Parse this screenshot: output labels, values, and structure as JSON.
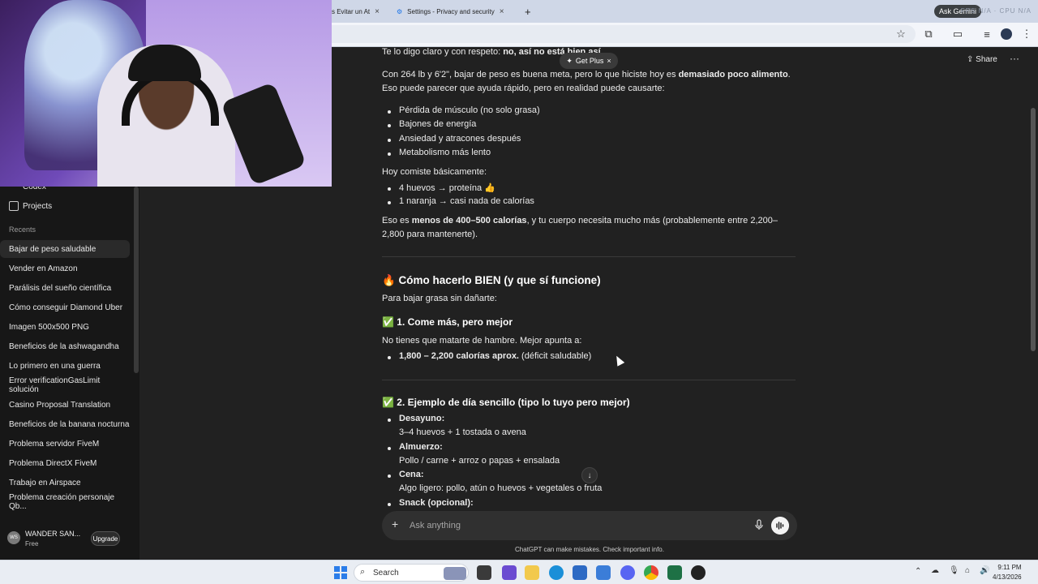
{
  "browser": {
    "tabs": [
      {
        "label": "s Evitar un At"
      },
      {
        "label": "Settings - Privacy and security"
      }
    ],
    "gemini_chip": "Ask Gemini",
    "overlay_stats": "FPS N/A · CPU N/A"
  },
  "sidebar": {
    "top_items": [
      {
        "label": "Codex"
      },
      {
        "label": "Projects"
      }
    ],
    "recents_label": "Recents",
    "recents": [
      {
        "label": "Bajar de peso saludable"
      },
      {
        "label": "Vender en Amazon"
      },
      {
        "label": "Parálisis del sueño científica"
      },
      {
        "label": "Cómo conseguir Diamond Uber"
      },
      {
        "label": "Imagen 500x500 PNG"
      },
      {
        "label": "Beneficios de la ashwagandha"
      },
      {
        "label": "Lo primero en una guerra"
      },
      {
        "label": "Error verificationGasLimit solución"
      },
      {
        "label": "Casino Proposal Translation"
      },
      {
        "label": "Beneficios de la banana nocturna"
      },
      {
        "label": "Problema servidor FiveM"
      },
      {
        "label": "Problema DirectX FiveM"
      },
      {
        "label": "Trabajo en Airspace"
      },
      {
        "label": "Problema creación personaje Qb..."
      }
    ],
    "user": {
      "initials": "WS",
      "name": "WANDER SAN...",
      "plan": "Free",
      "upgrade_label": "Upgrade"
    }
  },
  "header": {
    "get_plus": "Get Plus",
    "share": "Share"
  },
  "chat": {
    "intro_a": "Te lo digo claro y con respeto: ",
    "intro_b": "no, así no está bien así.",
    "p1_a": "Con 264 lb y 6'2\", bajar de peso es buena meta, pero lo que hiciste hoy es ",
    "p1_b": "demasiado poco alimento",
    "p1_c": ". Eso puede parecer que ayuda rápido, pero en realidad puede causarte:",
    "risks": [
      "Pérdida de músculo (no solo grasa)",
      "Bajones de energía",
      "Ansiedad y atracones después",
      "Metabolismo más lento"
    ],
    "p2": "Hoy comiste básicamente:",
    "ate": [
      "4 huevos → proteína 👍",
      "1 naranja → casi nada de calorías"
    ],
    "p3_a": "Eso es ",
    "p3_b": "menos de 400–500 calorías",
    "p3_c": ", y tu cuerpo necesita mucho más (probablemente entre 2,200–2,800 para mantenerte).",
    "h_how": "🔥 Cómo hacerlo BIEN (y que sí funcione)",
    "p4": "Para bajar grasa sin dañarte:",
    "h_1": "✅ 1. Come más, pero mejor",
    "p5": "No tienes que matarte de hambre. Mejor apunta a:",
    "target_b": "1,800 – 2,200 calorías aprox.",
    "target_c": " (déficit saludable)",
    "h_2": "✅ 2. Ejemplo de día sencillo (tipo lo tuyo pero mejor)",
    "meals": [
      {
        "name": "Desayuno:",
        "desc": "3–4 huevos + 1 tostada o avena"
      },
      {
        "name": "Almuerzo:",
        "desc": "Pollo / carne + arroz o papas + ensalada"
      },
      {
        "name": "Cena:",
        "desc": "Algo ligero: pollo, atún o huevos + vegetales o fruta"
      },
      {
        "name": "Snack (opcional):",
        "desc": ""
      }
    ]
  },
  "composer": {
    "placeholder": "Ask anything",
    "disclaimer": "ChatGPT can make mistakes. Check important info."
  },
  "taskbar": {
    "search_label": "Search",
    "time": "9:11 PM",
    "date": "4/13/2026"
  }
}
